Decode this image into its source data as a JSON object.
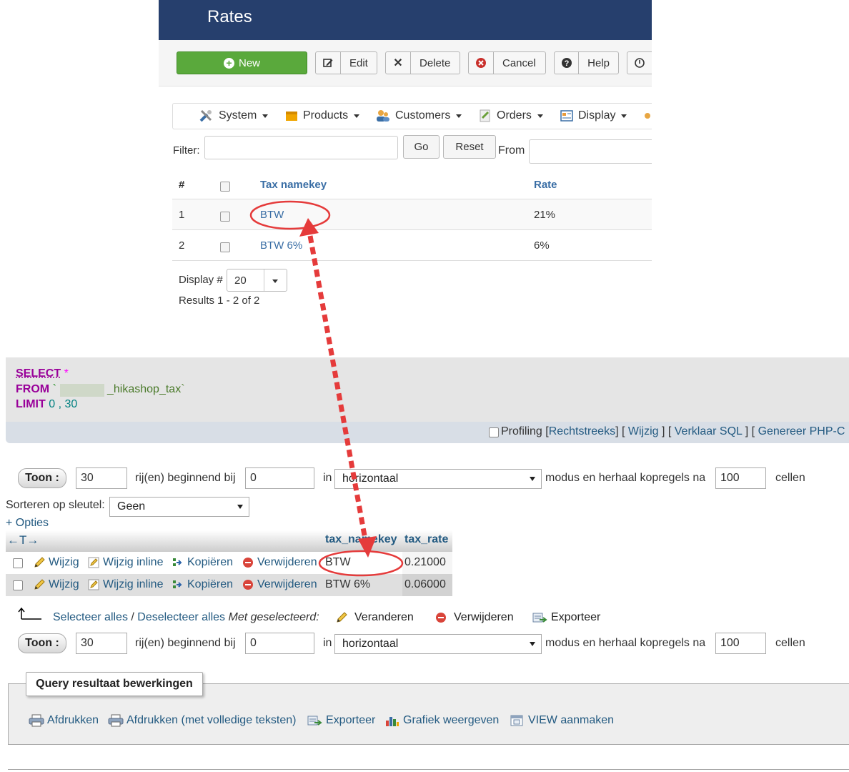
{
  "admin": {
    "title": "Rates",
    "toolbar": {
      "new": "New",
      "edit": "Edit",
      "delete": "Delete",
      "cancel": "Cancel",
      "help": "Help"
    },
    "menu": [
      "System",
      "Products",
      "Customers",
      "Orders",
      "Display"
    ],
    "filter": {
      "label": "Filter:",
      "value": "",
      "go": "Go",
      "reset": "Reset",
      "from_label": "From"
    },
    "table": {
      "headers": {
        "num": "#",
        "namekey": "Tax namekey",
        "rate": "Rate"
      },
      "rows": [
        {
          "num": "1",
          "namekey": "BTW",
          "rate": "21%"
        },
        {
          "num": "2",
          "namekey": "BTW 6%",
          "rate": "6%"
        }
      ]
    },
    "pagination": {
      "display_label": "Display #",
      "display_value": "20",
      "results": "Results 1 - 2 of 2"
    }
  },
  "pma": {
    "sql": {
      "select": "SELECT",
      "star": "*",
      "from": "FROM",
      "tick": "`",
      "table_suffix": "_hikashop_tax`",
      "limit": "LIMIT",
      "limit_args": "0 , 30"
    },
    "sqlbar": {
      "profiling": "Profiling",
      "rechtstreeks": "Rechtstreeks",
      "wijzig": "Wijzig",
      "verklaar": "Verklaar SQL",
      "genereer": "Genereer PHP-C"
    },
    "nav": {
      "toon": "Toon :",
      "rows": "30",
      "rows_label": "rij(en) beginnend bij",
      "start": "0",
      "in_label": "in",
      "mode": "horizontaal",
      "mode_label": "modus en herhaal kopregels na",
      "repeat": "100",
      "cells_label": "cellen"
    },
    "sort": {
      "label": "Sorteren op sleutel:",
      "value": "Geen"
    },
    "options_link": "+ Opties",
    "results": {
      "arrows": "←T→",
      "col1": "tax_namekey",
      "col2": "tax_rate",
      "actions": {
        "edit": "Wijzig",
        "edit_inline": "Wijzig inline",
        "copy": "Kopiëren",
        "delete": "Verwijderen"
      },
      "rows": [
        {
          "namekey": "BTW",
          "rate": "0.21000"
        },
        {
          "namekey": "BTW 6%",
          "rate": "0.06000"
        }
      ]
    },
    "bulk": {
      "select_all": "Selecteer alles",
      "sep": " / ",
      "deselect_all": "Deselecteer alles",
      "with_selected": "Met geselecteerd:",
      "change": "Veranderen",
      "delete": "Verwijderen",
      "export": "Exporteer"
    },
    "ops": {
      "legend": "Query resultaat bewerkingen",
      "print": "Afdrukken",
      "print_full": "Afdrukken (met volledige teksten)",
      "export": "Exporteer",
      "chart": "Grafiek weergeven",
      "view": "VIEW aanmaken"
    }
  },
  "colors": {
    "header_bg": "#263f6d",
    "new_green": "#5aa93c",
    "annotation_red": "#e53b3b",
    "link_blue": "#3a6ea5"
  }
}
